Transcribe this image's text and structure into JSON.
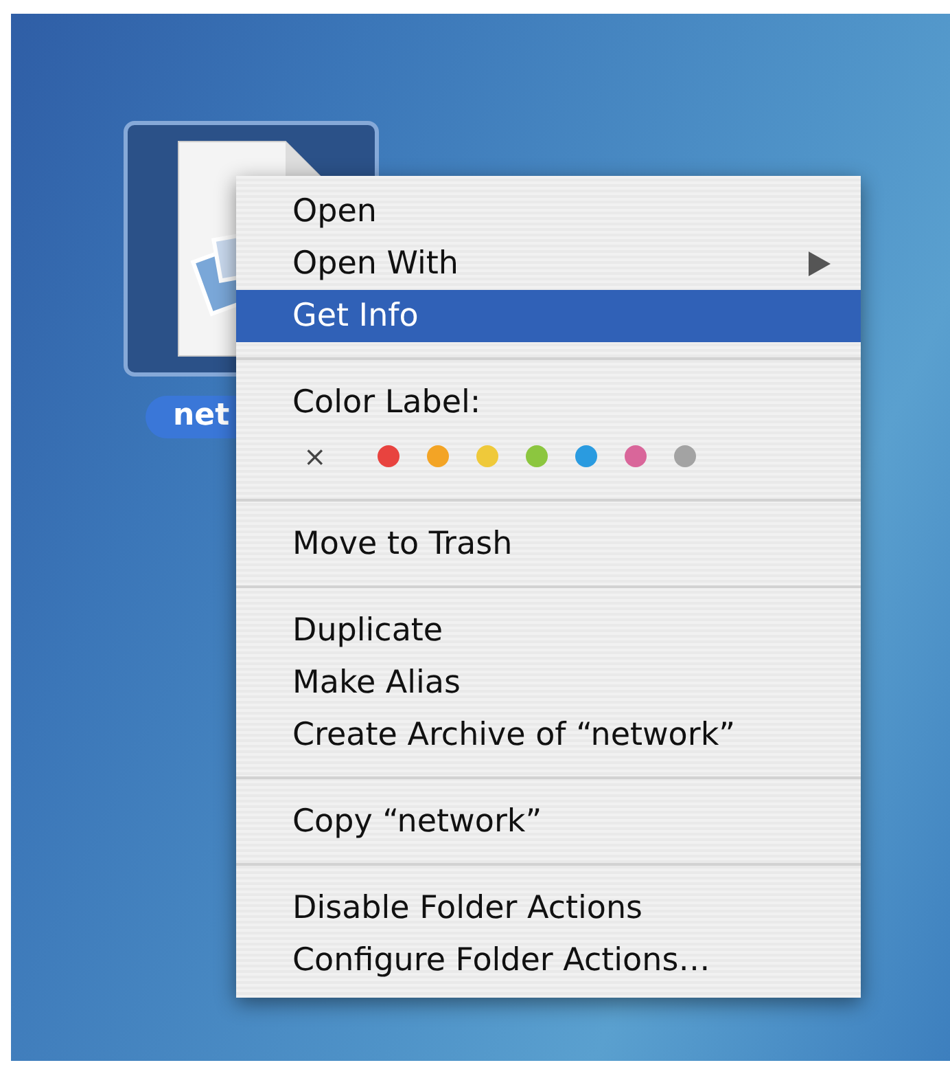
{
  "desktop": {
    "icon": {
      "label": "net",
      "selected": true
    }
  },
  "menu": {
    "sections": [
      {
        "kind": "items",
        "items": [
          {
            "label": "Open",
            "selected": false,
            "submenu": false
          },
          {
            "label": "Open With",
            "selected": false,
            "submenu": true
          },
          {
            "label": "Get Info",
            "selected": true,
            "submenu": false
          }
        ]
      },
      {
        "kind": "colors",
        "title": "Color Label:",
        "none": "×",
        "colors": [
          {
            "color": "#e8433f"
          },
          {
            "color": "#f3a425"
          },
          {
            "color": "#efc93a"
          },
          {
            "color": "#8cc63f"
          },
          {
            "color": "#2a9be0"
          },
          {
            "color": "#d9669a"
          },
          {
            "color": "#a3a3a3"
          }
        ]
      },
      {
        "kind": "items",
        "items": [
          {
            "label": "Move to Trash",
            "selected": false,
            "submenu": false
          }
        ]
      },
      {
        "kind": "items",
        "items": [
          {
            "label": "Duplicate",
            "selected": false,
            "submenu": false
          },
          {
            "label": "Make Alias",
            "selected": false,
            "submenu": false
          },
          {
            "label": "Create Archive of “network”",
            "selected": false,
            "submenu": false
          }
        ]
      },
      {
        "kind": "items",
        "items": [
          {
            "label": "Copy “network”",
            "selected": false,
            "submenu": false
          }
        ]
      },
      {
        "kind": "items",
        "items": [
          {
            "label": "Disable Folder Actions",
            "selected": false,
            "submenu": false
          },
          {
            "label": "Configure Folder Actions…",
            "selected": false,
            "submenu": false
          }
        ]
      }
    ]
  }
}
